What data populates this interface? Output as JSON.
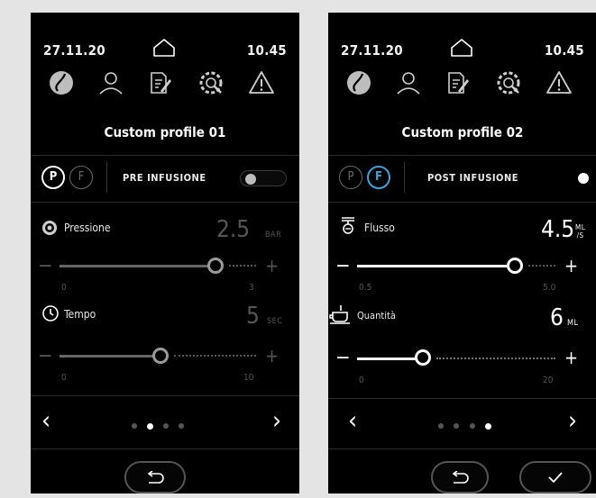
{
  "screens": [
    {
      "date": "27.11.20",
      "time": "10.45",
      "title": "Custom profile 01",
      "mode": "PRE INFUSIONE",
      "p_badge": "P",
      "f_badge": "F",
      "params": [
        {
          "label": "Pressione",
          "value": "2.5",
          "unit": "BAR",
          "min": "0",
          "max": "3"
        },
        {
          "label": "Tempo",
          "value": "5",
          "unit": "SEC",
          "min": "0",
          "max": "10"
        }
      ],
      "pager": {
        "count": 4,
        "active": 2
      }
    },
    {
      "date": "27.11.20",
      "time": "10.45",
      "title": "Custom profile 02",
      "mode": "POST INFUSIONE",
      "p_badge": "P",
      "f_badge": "F",
      "params": [
        {
          "label": "Flusso",
          "value": "4.5",
          "unit_top": "ML",
          "unit_bottom": "/S",
          "min": "0.5",
          "max": "5.0"
        },
        {
          "label": "Quantità",
          "value": "6",
          "unit": "ML",
          "min": "0",
          "max": "20"
        }
      ],
      "pager": {
        "count": 4,
        "active": 4
      }
    }
  ],
  "colors": {
    "accent": "#3ba3dd",
    "background": "#000000",
    "muted": "#555555"
  },
  "icons": [
    "home-icon",
    "coffee-bean-icon",
    "user-icon",
    "recipe-icon",
    "settings-icon",
    "warning-icon",
    "gauge-icon",
    "timer-icon",
    "flow-icon",
    "cup-icon",
    "undo-icon",
    "check-icon"
  ]
}
